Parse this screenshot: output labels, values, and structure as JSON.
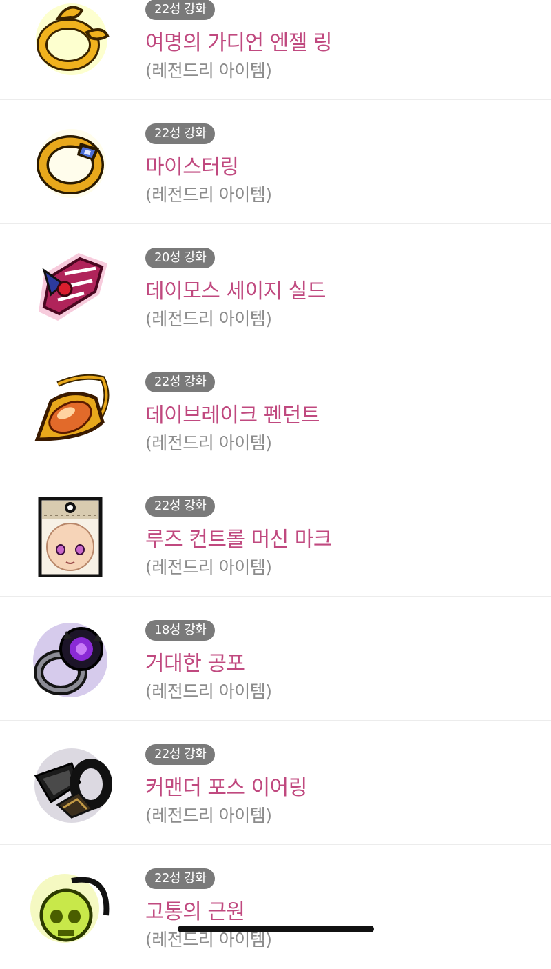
{
  "items": [
    {
      "badge": "22성 강화",
      "name": "여명의 가디언 엔젤 링",
      "grade": "(레전드리 아이템)",
      "icon": "dawn-guardian-angel-ring-icon"
    },
    {
      "badge": "22성 강화",
      "name": "마이스터링",
      "grade": "(레전드리 아이템)",
      "icon": "meister-ring-icon"
    },
    {
      "badge": "20성 강화",
      "name": "데이모스 세이지 실드",
      "grade": "(레전드리 아이템)",
      "icon": "deimos-sage-shield-icon"
    },
    {
      "badge": "22성 강화",
      "name": "데이브레이크 펜던트",
      "grade": "(레전드리 아이템)",
      "icon": "daybreak-pendant-icon"
    },
    {
      "badge": "22성 강화",
      "name": "루즈 컨트롤 머신 마크",
      "grade": "(레전드리 아이템)",
      "icon": "loose-control-machine-mark-icon"
    },
    {
      "badge": "18성 강화",
      "name": "거대한 공포",
      "grade": "(레전드리 아이템)",
      "icon": "magnificent-fear-icon"
    },
    {
      "badge": "22성 강화",
      "name": "커맨더 포스 이어링",
      "grade": "(레전드리 아이템)",
      "icon": "commander-force-earring-icon"
    },
    {
      "badge": "22성 강화",
      "name": "고통의 근원",
      "grade": "(레전드리 아이템)",
      "icon": "source-of-suffering-icon"
    }
  ],
  "colors": {
    "item_name": "#c0497f",
    "grade_text": "#8c8c8c",
    "badge_bg": "#7a7a7a",
    "divider": "#ececec"
  }
}
